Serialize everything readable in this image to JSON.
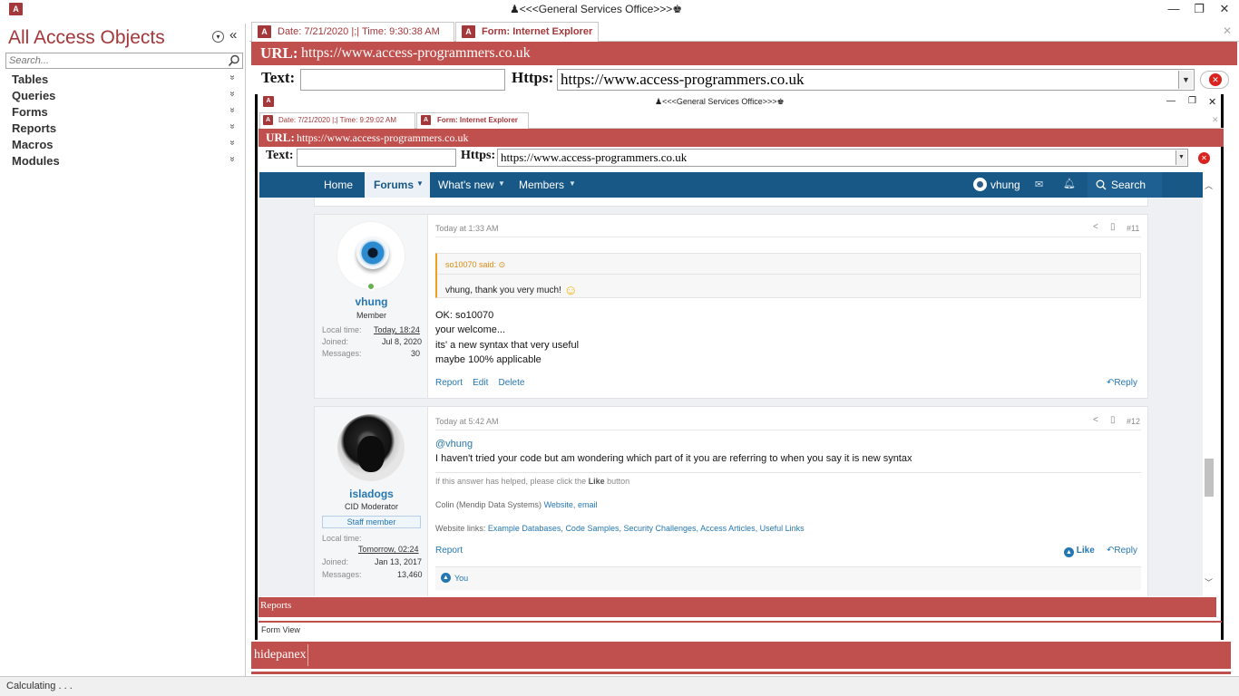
{
  "app": {
    "title": "<<<General Services Office>>>",
    "logo_text": "A",
    "accent": "#a4373a",
    "form_bar_color": "#c0504d"
  },
  "window_buttons": {
    "minimize": "—",
    "restore": "❐",
    "close": "✕"
  },
  "nav": {
    "title": "All Access Objects",
    "collapse": "«",
    "menu_glyph": "▾",
    "search_placeholder": "Search...",
    "items": [
      {
        "label": "Tables",
        "chev": "»"
      },
      {
        "label": "Queries",
        "chev": "»"
      },
      {
        "label": "Forms",
        "chev": "»"
      },
      {
        "label": "Reports",
        "chev": "»"
      },
      {
        "label": "Macros",
        "chev": "»"
      },
      {
        "label": "Modules",
        "chev": "»"
      }
    ]
  },
  "outer": {
    "tabs": [
      {
        "label": "Date: 7/21/2020 |;| Time: 9:30:38 AM"
      },
      {
        "label": "Form: Internet Explorer"
      }
    ],
    "tab_close": "✕",
    "url_label": "URL:",
    "url_value": "https://www.access-programmers.co.uk",
    "text_label": "Text:",
    "text_value": "",
    "https_label": "Https:",
    "https_value": "https://www.access-programmers.co.uk",
    "close_glyph": "✕"
  },
  "inner": {
    "title": "<<<General Services Office>>>",
    "tabs": [
      {
        "label": "Date: 7/21/2020 |;| Time: 9:29:02 AM"
      },
      {
        "label": "Form: Internet Explorer"
      }
    ],
    "url_label": "URL:",
    "url_value": "https://www.access-programmers.co.uk",
    "text_label": "Text:",
    "https_label": "Https:",
    "https_value": "https://www.access-programmers.co.uk",
    "reports_label": "Reports",
    "form_view_label": "Form View"
  },
  "forum": {
    "nav": {
      "home": "Home",
      "forums": "Forums",
      "whats_new": "What's new",
      "members": "Members",
      "user": "vhung",
      "search": "Search"
    },
    "posts": [
      {
        "time": "Today at 1:33 AM",
        "number": "#11",
        "author": "vhung",
        "role": "Member",
        "meta": [
          {
            "k": "Local time:",
            "v": "Today, 18:24"
          },
          {
            "k": "Joined:",
            "v": "Jul 8, 2020"
          },
          {
            "k": "Messages:",
            "v": "30"
          }
        ],
        "quote_author": "so10070 said:",
        "quote_text": "vhung, thank you very much!",
        "lines": [
          "OK: so10070",
          "your welcome...",
          "its' a new syntax that very useful",
          "maybe 100% applicable"
        ],
        "actions": [
          "Report",
          "Edit",
          "Delete"
        ],
        "reply": "Reply"
      },
      {
        "time": "Today at 5:42 AM",
        "number": "#12",
        "author": "isladogs",
        "role": "CID Moderator",
        "badge": "Staff member",
        "meta": [
          {
            "k": "Local time:",
            "v": ""
          },
          {
            "k": "",
            "v": "Tomorrow, 02:24"
          },
          {
            "k": "Joined:",
            "v": "Jan 13, 2017"
          },
          {
            "k": "Messages:",
            "v": "13,460"
          }
        ],
        "mention": "@vhung",
        "line": "I haven't tried your code but am wondering which part of it you are referring to when you say it is new syntax",
        "sig1_pre": "If this answer has helped, please click the",
        "sig1_like": "Like",
        "sig1_post": "button",
        "sig2_pre": "Colin (Mendip Data Systems)",
        "sig2_website": "Website,",
        "sig2_email": "email",
        "sig3_pre": "Website links:",
        "sig3_links": [
          "Example Databases,",
          "Code Samples,",
          "Security Challenges,",
          "Access Articles,",
          "Useful Links"
        ],
        "report": "Report",
        "like": "Like",
        "reply": "Reply",
        "reaction": "You"
      }
    ]
  },
  "hidepane_label": "hidepanex",
  "status": "Calculating . . ."
}
